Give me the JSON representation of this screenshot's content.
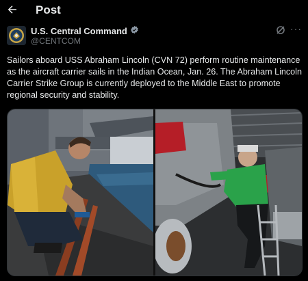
{
  "header": {
    "title": "Post"
  },
  "author": {
    "name": "U.S. Central Command",
    "handle": "@CENTCOM",
    "verified_icon": "verified-badge-icon"
  },
  "tweet": {
    "text": "Sailors aboard USS Abraham Lincoln (CVN 72) perform routine maintenance as the aircraft carrier sails in the Indian Ocean, Jan. 26. The Abraham Lincoln Carrier Strike Group is currently deployed to the Middle East to promote regional security and stability."
  },
  "media": {
    "photos": [
      {
        "label": "Sailor in yellow vest cleaning flight deck edge"
      },
      {
        "label": "Sailor in green shirt maintaining aircraft in hangar bay"
      }
    ]
  },
  "colors": {
    "background": "#000000",
    "text": "#e7e9ea",
    "secondary": "#71767b",
    "verified": "#8b98a5",
    "border": "#2f3336"
  }
}
